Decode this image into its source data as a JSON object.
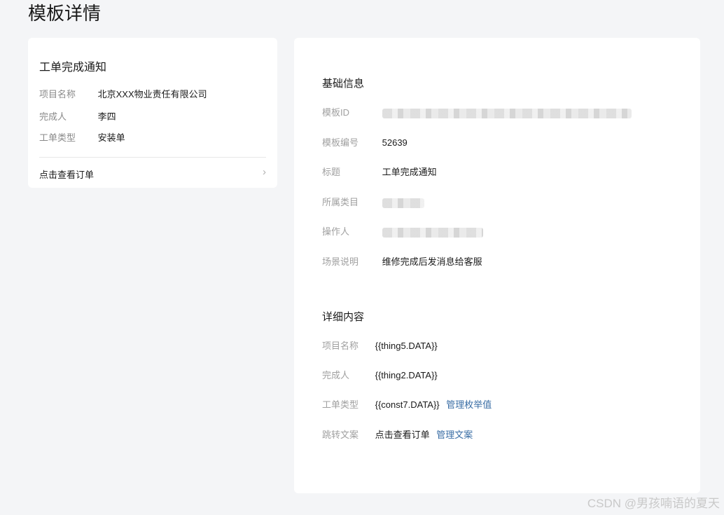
{
  "page": {
    "title": "模板详情"
  },
  "preview": {
    "title": "工单完成通知",
    "rows": [
      {
        "label": "项目名称",
        "value": "北京XXX物业责任有限公司"
      },
      {
        "label": "完成人",
        "value": "李四"
      },
      {
        "label": "工单类型",
        "value": "安装单"
      }
    ],
    "link_text": "点击查看订单",
    "link_chevron": "›"
  },
  "basic_info": {
    "section_title": "基础信息",
    "rows": [
      {
        "label": "模板ID",
        "value": ""
      },
      {
        "label": "模板编号",
        "value": "52639"
      },
      {
        "label": "标题",
        "value": "工单完成通知"
      },
      {
        "label": "所属类目",
        "value": ""
      },
      {
        "label": "操作人",
        "value": ""
      },
      {
        "label": "场景说明",
        "value": "维修完成后发消息给客服"
      }
    ]
  },
  "detail_content": {
    "section_title": "详细内容",
    "rows": [
      {
        "label": "项目名称",
        "value": "{{thing5.DATA}}",
        "link": ""
      },
      {
        "label": "完成人",
        "value": "{{thing2.DATA}}",
        "link": ""
      },
      {
        "label": "工单类型",
        "value": "{{const7.DATA}}",
        "link": "管理枚举值"
      },
      {
        "label": "跳转文案",
        "value": "点击查看订单",
        "link": "管理文案"
      }
    ]
  },
  "watermark": "CSDN @男孩喃语的夏天",
  "colors": {
    "background": "#f4f5f7",
    "card": "#ffffff",
    "label": "#a0a0a0",
    "link": "#3a6ea5"
  }
}
